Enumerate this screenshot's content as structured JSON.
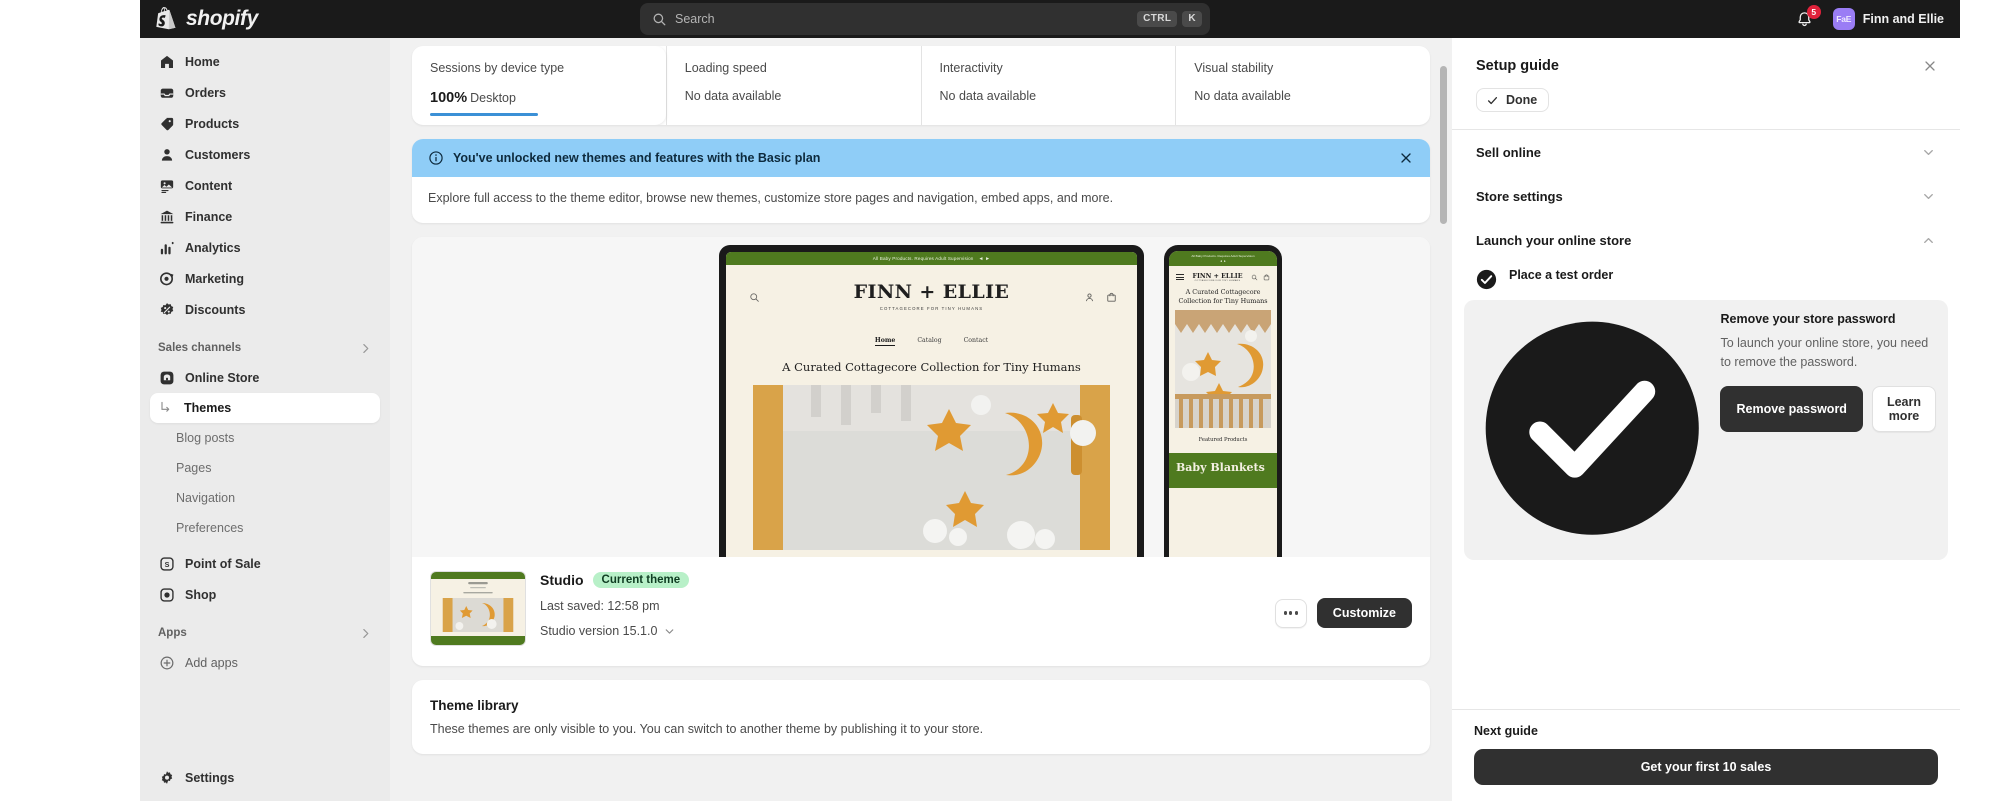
{
  "topbar": {
    "brand": "shopify",
    "search": {
      "placeholder": "Search",
      "kbd1": "CTRL",
      "kbd2": "K"
    },
    "notifications_count": "5",
    "user": {
      "initials": "FaE",
      "name": "Finn and Ellie"
    }
  },
  "sidebar": {
    "primary": [
      {
        "label": "Home",
        "icon": "home-icon"
      },
      {
        "label": "Orders",
        "icon": "orders-icon"
      },
      {
        "label": "Products",
        "icon": "products-icon"
      },
      {
        "label": "Customers",
        "icon": "customers-icon"
      },
      {
        "label": "Content",
        "icon": "content-icon"
      },
      {
        "label": "Finance",
        "icon": "finance-icon"
      },
      {
        "label": "Analytics",
        "icon": "analytics-icon"
      },
      {
        "label": "Marketing",
        "icon": "marketing-icon"
      },
      {
        "label": "Discounts",
        "icon": "discounts-icon"
      }
    ],
    "sales_channels": {
      "label": "Sales channels",
      "online_store": "Online Store",
      "sub": [
        "Themes",
        "Blog posts",
        "Pages",
        "Navigation",
        "Preferences"
      ],
      "point_of_sale": "Point of Sale",
      "shop": "Shop"
    },
    "apps": {
      "label": "Apps",
      "add": "Add apps"
    },
    "settings": "Settings"
  },
  "metrics": [
    {
      "title": "Sessions by device type",
      "value": "100%",
      "value_sub": "Desktop",
      "has_bar": true
    },
    {
      "title": "Loading speed",
      "value": "No data available"
    },
    {
      "title": "Interactivity",
      "value": "No data available"
    },
    {
      "title": "Visual stability",
      "value": "No data available"
    }
  ],
  "banner": {
    "headline": "You've unlocked new themes and features with the Basic plan",
    "body": "Explore full access to the theme editor, browse new themes, customize store pages and navigation, embed apps, and more."
  },
  "preview": {
    "desktop": {
      "announcement": "All Baby Products. Requires Adult Supervision",
      "logo": "FINN + ELLIE",
      "tagline": "COTTAGECORE FOR TINY HUMANS",
      "nav": [
        "Home",
        "Catalog",
        "Contact"
      ],
      "hero_title": "A Curated Cottagecore Collection for Tiny Humans"
    },
    "mobile": {
      "announcement": "All Baby Products. Requires Adult Supervision",
      "logo": "FINN + ELLIE",
      "tagline": "COTTAGECORE FOR TINY HUMANS",
      "hero_title": "A Curated Cottagecore Collection for Tiny Humans",
      "featured": "Featured Products",
      "band_title": "Baby Blankets"
    }
  },
  "theme": {
    "name": "Studio",
    "badge": "Current theme",
    "last_saved": "Last saved: 12:58 pm",
    "version": "Studio version 15.1.0",
    "customize_label": "Customize"
  },
  "library": {
    "title": "Theme library",
    "subtitle": "These themes are only visible to you. You can switch to another theme by publishing it to your store."
  },
  "setup_guide": {
    "title": "Setup guide",
    "done_label": "Done",
    "sections": [
      {
        "label": "Sell online",
        "expanded": false
      },
      {
        "label": "Store settings",
        "expanded": false
      },
      {
        "label": "Launch your online store",
        "expanded": true
      }
    ],
    "tasks": [
      {
        "label": "Place a test order",
        "complete": true,
        "open": false
      },
      {
        "label": "Remove your store password",
        "complete": true,
        "open": true,
        "description": "To launch your online store, you need to remove the password.",
        "primary_button": "Remove password",
        "secondary_button": "Learn more"
      }
    ],
    "next_guide_label": "Next guide",
    "next_guide_button": "Get your first 10 sales"
  },
  "colors": {
    "topbar_bg": "#1a1a1a",
    "sidebar_bg": "#ebebeb",
    "canvas_bg": "#f1f1f1",
    "banner_accent": "#8fcdf7",
    "metric_bar": "#3b90d6",
    "badge_green": "#b8f0c8",
    "button_dark": "#303030",
    "avatar": "#9a7df5",
    "notification": "#e0223b",
    "store_green": "#4f7a1f",
    "store_cream": "#f6f1e4",
    "store_orange": "#d9a349"
  }
}
